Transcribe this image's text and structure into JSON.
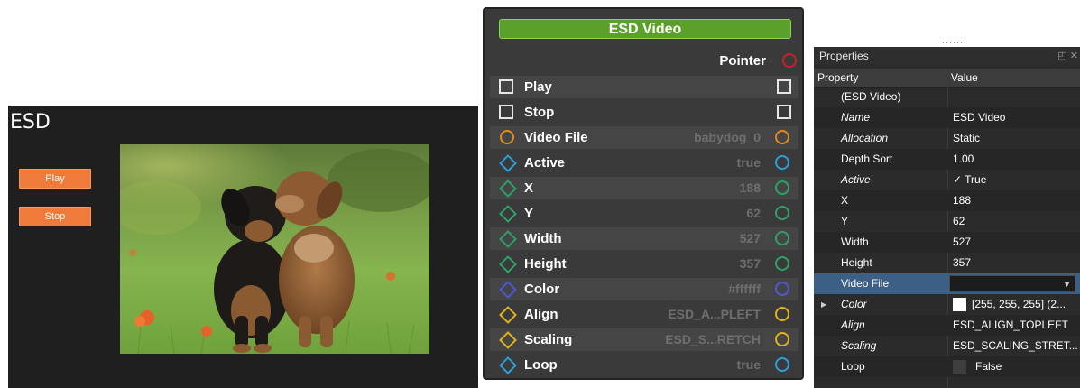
{
  "preview": {
    "title": "ESD",
    "play_button": "Play",
    "stop_button": "Stop"
  },
  "node": {
    "title": "ESD Video",
    "pointer_label": "Pointer",
    "rows": [
      {
        "label": "Play",
        "value": ""
      },
      {
        "label": "Stop",
        "value": ""
      },
      {
        "label": "Video File",
        "value": "babydog_0"
      },
      {
        "label": "Active",
        "value": "true"
      },
      {
        "label": "X",
        "value": "188"
      },
      {
        "label": "Y",
        "value": "62"
      },
      {
        "label": "Width",
        "value": "527"
      },
      {
        "label": "Height",
        "value": "357"
      },
      {
        "label": "Color",
        "value": "#ffffff"
      },
      {
        "label": "Align",
        "value": "ESD_A...PLEFT"
      },
      {
        "label": "Scaling",
        "value": "ESD_S...RETCH"
      },
      {
        "label": "Loop",
        "value": "true"
      }
    ],
    "colors": {
      "pointer": "#c8202a",
      "string": "#e08a1e",
      "bool": "#2c9ed8",
      "number": "#2fa06a",
      "color": "#4a5ad6",
      "enum": "#e0b21e"
    }
  },
  "properties": {
    "title": "Properties",
    "col_property": "Property",
    "col_value": "Value",
    "rows": [
      {
        "name": "(ESD Video)",
        "value": ""
      },
      {
        "name": "Name",
        "value": "ESD Video"
      },
      {
        "name": "Allocation",
        "value": "Static"
      },
      {
        "name": "Depth Sort",
        "value": "1.00"
      },
      {
        "name": "Active",
        "value": "✓ True"
      },
      {
        "name": "X",
        "value": "188"
      },
      {
        "name": "Y",
        "value": "62"
      },
      {
        "name": "Width",
        "value": "527"
      },
      {
        "name": "Height",
        "value": "357"
      },
      {
        "name": "Video File",
        "value": ""
      },
      {
        "name": "Color",
        "value": "[255, 255, 255] (2..."
      },
      {
        "name": "Align",
        "value": "ESD_ALIGN_TOPLEFT"
      },
      {
        "name": "Scaling",
        "value": "ESD_SCALING_STRET..."
      },
      {
        "name": "Loop",
        "value": "False"
      }
    ]
  }
}
